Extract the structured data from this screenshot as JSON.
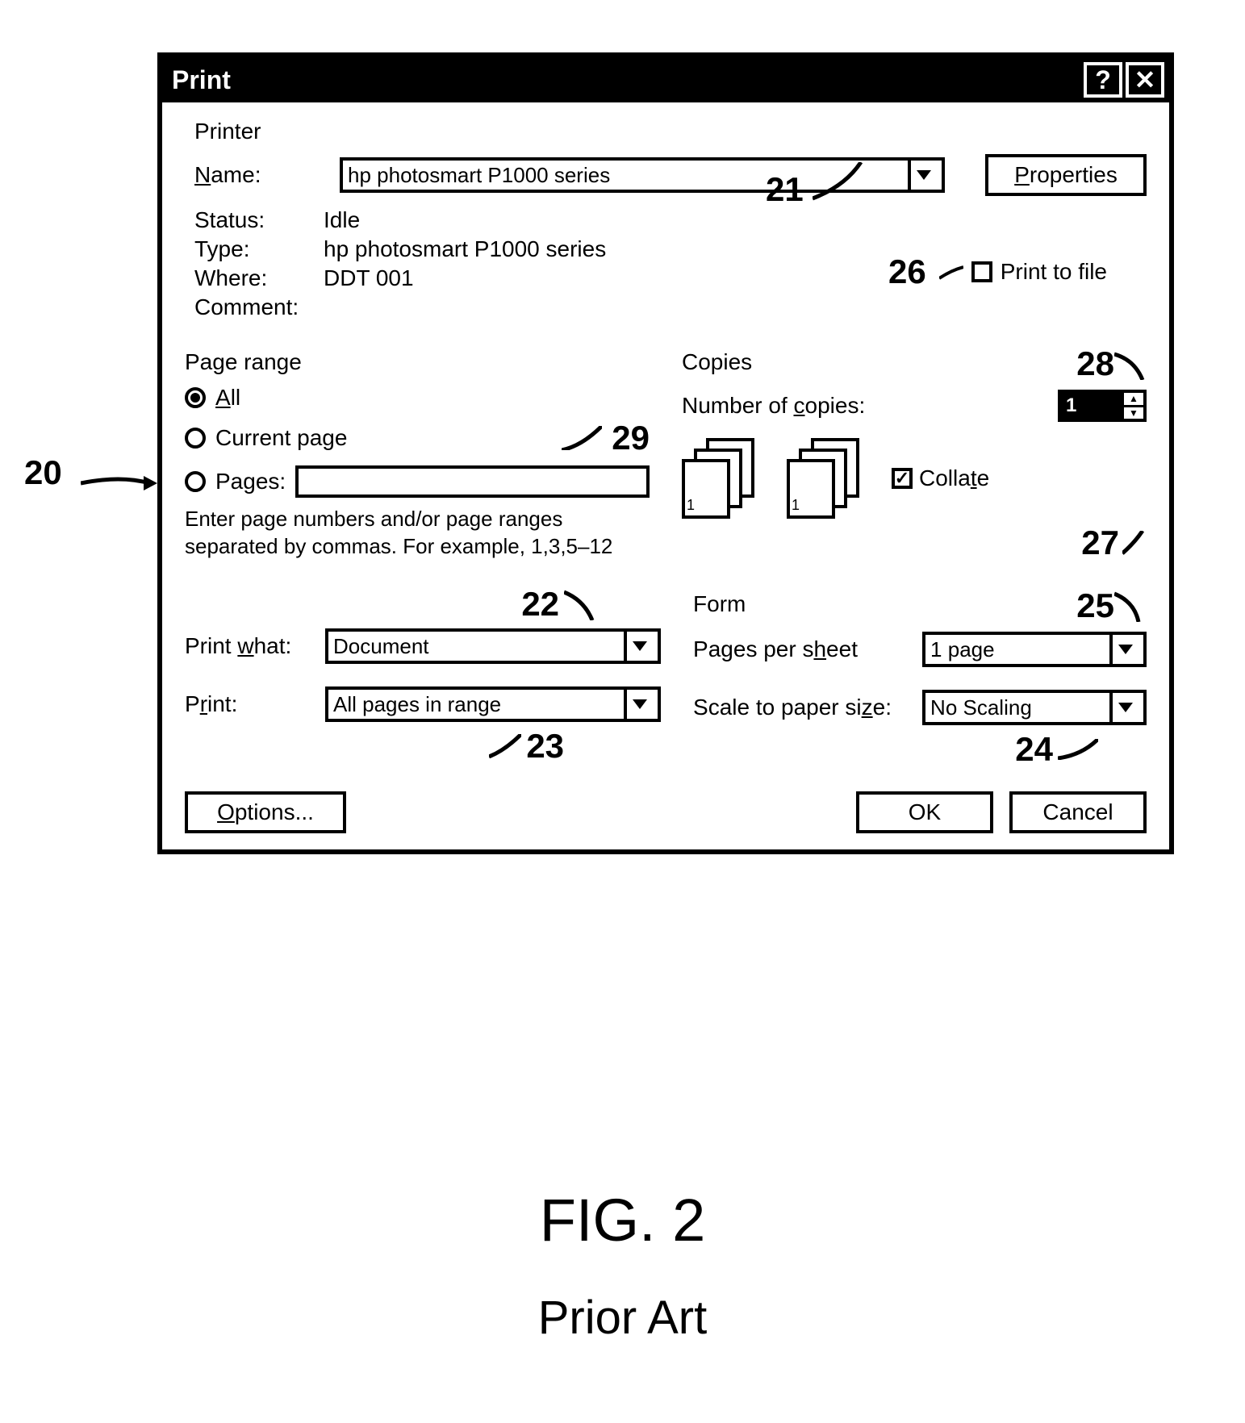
{
  "title": "Print",
  "printer": {
    "section": "Printer",
    "name_label_pre": "N",
    "name_label_post": "ame:",
    "name_value": "hp photosmart P1000 series",
    "properties_pre": "P",
    "properties_post": "roperties",
    "status_label": "Status:",
    "status_value": "Idle",
    "type_label": "Type:",
    "type_value": "hp photosmart P1000 series",
    "where_label": "Where:",
    "where_value": "DDT   001",
    "comment_label": "Comment:",
    "print_to_file": "Print to file"
  },
  "pageRange": {
    "section": "Page range",
    "all_pre": "A",
    "all_post": "ll",
    "current": "Current page",
    "pages_pre": "Pa",
    "pages_mid": "g",
    "pages_post": "es:",
    "help": "Enter page numbers and/or page ranges separated by commas. For example, 1,3,5–12"
  },
  "copies": {
    "section": "Copies",
    "num_label_pre": "Number of ",
    "num_label_mid": "c",
    "num_label_post": "opies:",
    "value": "1",
    "collate_pre": "Colla",
    "collate_mid": "t",
    "collate_post": "e"
  },
  "printWhat": {
    "label_pre": "Print ",
    "label_mid": "w",
    "label_post": "hat:",
    "value": "Document"
  },
  "printSel": {
    "label_pre": "P",
    "label_mid": "r",
    "label_post": "int:",
    "value": "All pages in range"
  },
  "form": {
    "section": "Form",
    "pps_pre": "Pages per s",
    "pps_mid": "h",
    "pps_post": "eet",
    "pps_value": "1 page",
    "scale_pre": "Scale to paper si",
    "scale_mid": "z",
    "scale_post": "e:",
    "scale_value": "No Scaling"
  },
  "footer": {
    "options_pre": "O",
    "options_post": "ptions...",
    "ok": "OK",
    "cancel": "Cancel"
  },
  "annotations": {
    "a20": "20",
    "a21": "21",
    "a22": "22",
    "a23": "23",
    "a24": "24",
    "a25": "25",
    "a26": "26",
    "a27": "27",
    "a28": "28",
    "a29": "29"
  },
  "figure": {
    "title": "FIG. 2",
    "subtitle": "Prior Art"
  }
}
